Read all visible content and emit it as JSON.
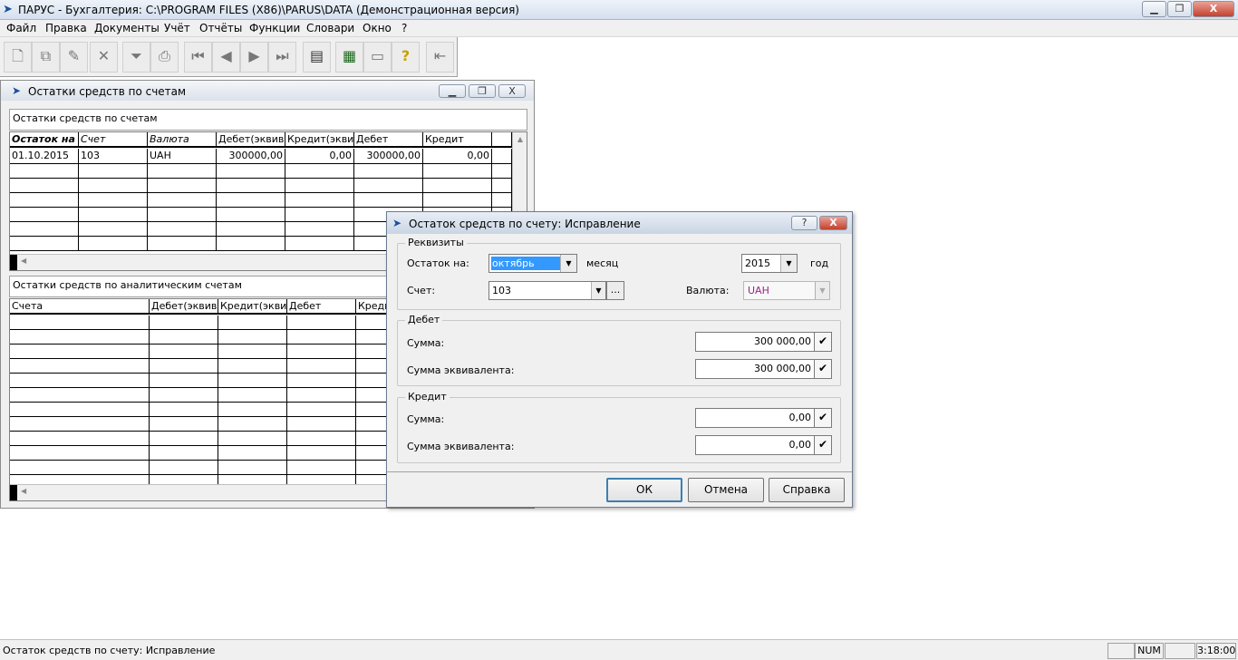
{
  "app": {
    "title": "ПАРУС - Бухгалтерия: C:\\PROGRAM FILES (X86)\\PARUS\\DATA (Демонстрационная версия)",
    "window_buttons": {
      "minimize": "▁",
      "maximize": "❐",
      "close": "X"
    }
  },
  "menu": [
    {
      "label": "Файл"
    },
    {
      "label": "Правка"
    },
    {
      "label": "Документы"
    },
    {
      "label": "Учёт"
    },
    {
      "label": "Отчёты"
    },
    {
      "label": "Функции"
    },
    {
      "label": "Словари"
    },
    {
      "label": "Окно"
    },
    {
      "label": "?"
    }
  ],
  "toolbar": {
    "icons": [
      "new-icon",
      "copy-icon",
      "edit-icon",
      "delete-icon",
      "filter-icon",
      "print-icon",
      "first-icon",
      "prev-icon",
      "next-icon",
      "last-icon",
      "calc-list-icon",
      "calculator-icon",
      "garant-icon",
      "help-icon",
      "exit-icon"
    ],
    "glyphs": [
      "🗋",
      "⧉",
      "✎",
      "✕",
      "⏷",
      "⎙",
      "⏮",
      "◀",
      "▶",
      "⏭",
      "▤",
      "▦",
      "▭",
      "?",
      "⇤"
    ]
  },
  "mdi": {
    "title": "Остатки средств по счетам",
    "top_pane_label": "Остатки средств по счетам",
    "top_columns": [
      "Остаток на",
      "Счет",
      "Валюта",
      "Дебет(эквивалент)",
      "Кредит(эквивалент)",
      "Дебет",
      "Кредит"
    ],
    "top_rows": [
      [
        "01.10.2015",
        "103",
        "UAH",
        "300000,00",
        "0,00",
        "300000,00",
        "0,00"
      ]
    ],
    "bottom_pane_label": "Остатки средств по аналитическим счетам",
    "bottom_columns": [
      "Счета",
      "Дебет(эквивалент)",
      "Кредит(эквивалент)",
      "Дебет",
      "Кредит"
    ]
  },
  "dialog": {
    "title": "Остаток средств по счету: Исправление",
    "help_btn": "?",
    "close_btn": "X",
    "rekvizity": {
      "title": "Реквизиты",
      "ostatok_label": "Остаток на:",
      "month_value": "октябрь",
      "month_label": "месяц",
      "year_value": "2015",
      "year_label": "год",
      "schet_label": "Счет:",
      "schet_value": "103",
      "browse": "...",
      "valuta_label": "Валюта:",
      "valuta_value": "UAH"
    },
    "debet": {
      "title": "Дебет",
      "summa_label": "Сумма:",
      "summa_value": "300 000,00",
      "ekv_label": "Сумма эквивалента:",
      "ekv_value": "300 000,00"
    },
    "kredit": {
      "title": "Кредит",
      "summa_label": "Сумма:",
      "summa_value": "0,00",
      "ekv_label": "Сумма эквивалента:",
      "ekv_value": "0,00"
    },
    "buttons": {
      "ok": "ОК",
      "cancel": "Отмена",
      "help": "Справка"
    }
  },
  "status": {
    "text": "Остаток средств по счету: Исправление",
    "num": "NUM",
    "time": "3:18:00"
  },
  "colors": {
    "accent": "#3399ff",
    "currency": "#a0208a"
  }
}
